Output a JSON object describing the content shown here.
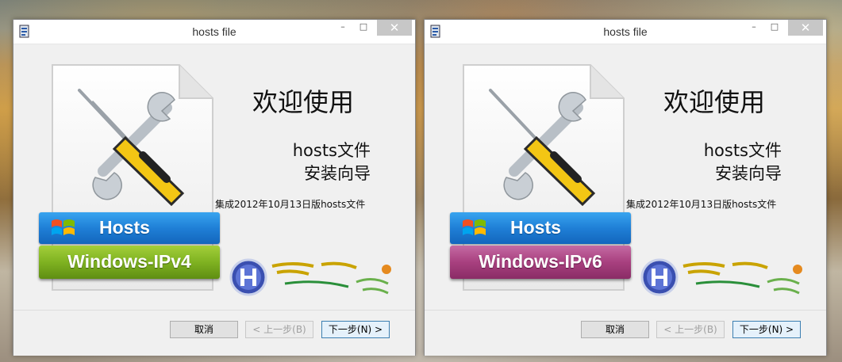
{
  "windows": [
    {
      "title": "hosts file",
      "title_buttons": {
        "minimize": "–",
        "maximize": "□",
        "close": "✕"
      },
      "heading": "欢迎使用",
      "subtitle_line1": "hosts文件",
      "subtitle_line2": "安装向导",
      "description": "集成2012年10月13日版hosts文件",
      "banner_top": "Hosts",
      "banner_bottom": "Windows-IPv4",
      "banner_bottom_color": "#7fb221",
      "buttons": {
        "cancel": "取消",
        "back": "< 上一步(B)",
        "next": "下一步(N) >"
      }
    },
    {
      "title": "hosts file",
      "title_buttons": {
        "minimize": "–",
        "maximize": "□",
        "close": "✕"
      },
      "heading": "欢迎使用",
      "subtitle_line1": "hosts文件",
      "subtitle_line2": "安装向导",
      "description": "集成2012年10月13日版hosts文件",
      "banner_top": "Hosts",
      "banner_bottom": "Windows-IPv6",
      "banner_bottom_color": "#a8407f",
      "buttons": {
        "cancel": "取消",
        "back": "< 上一步(B)",
        "next": "下一步(N) >"
      }
    }
  ],
  "colors": {
    "accent_blue": "#1f7fd6",
    "window_bg": "#f0f0f0"
  },
  "icons": [
    "installer-app-icon",
    "document-icon",
    "wrench-icon",
    "screwdriver-icon",
    "windows-flag-icon",
    "brand-logo-icon"
  ]
}
